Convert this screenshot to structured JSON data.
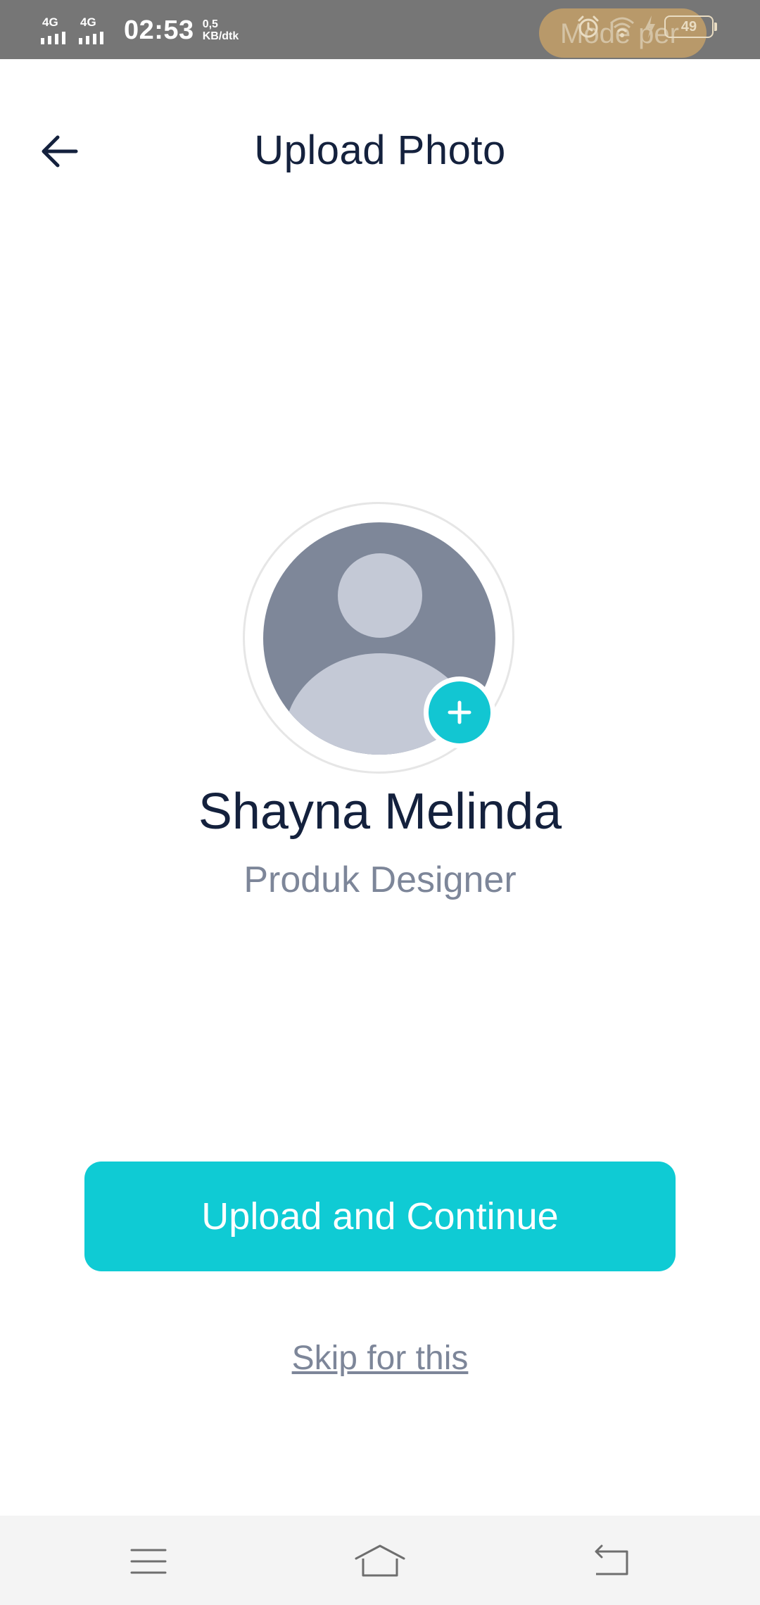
{
  "status_bar": {
    "signal_1_label": "4G",
    "signal_2_label": "4G",
    "time": "02:53",
    "speed_value": "0,5",
    "speed_unit": "KB/dtk",
    "mode_pill_text": "Mode per",
    "battery_level": "49",
    "icons": [
      "alarm-icon",
      "wifi-icon",
      "charging-icon",
      "battery-icon"
    ]
  },
  "header": {
    "title": "Upload Photo",
    "back_icon": "arrow-left-icon"
  },
  "profile": {
    "name": "Shayna Melinda",
    "role": "Produk Designer",
    "avatar_icon": "avatar-placeholder-icon",
    "add_icon": "plus-icon"
  },
  "actions": {
    "primary_label": "Upload and Continue",
    "skip_label": "Skip for this"
  },
  "nav_bar": {
    "icons": [
      "menu-icon",
      "home-icon",
      "back-icon"
    ]
  },
  "colors": {
    "accent": "#0fcbd4",
    "title_text": "#14213d",
    "secondary_text": "#7d8699",
    "status_bar_bg": "#767676",
    "avatar_bg": "#7e8799",
    "avatar_fg": "#c4c9d6"
  }
}
